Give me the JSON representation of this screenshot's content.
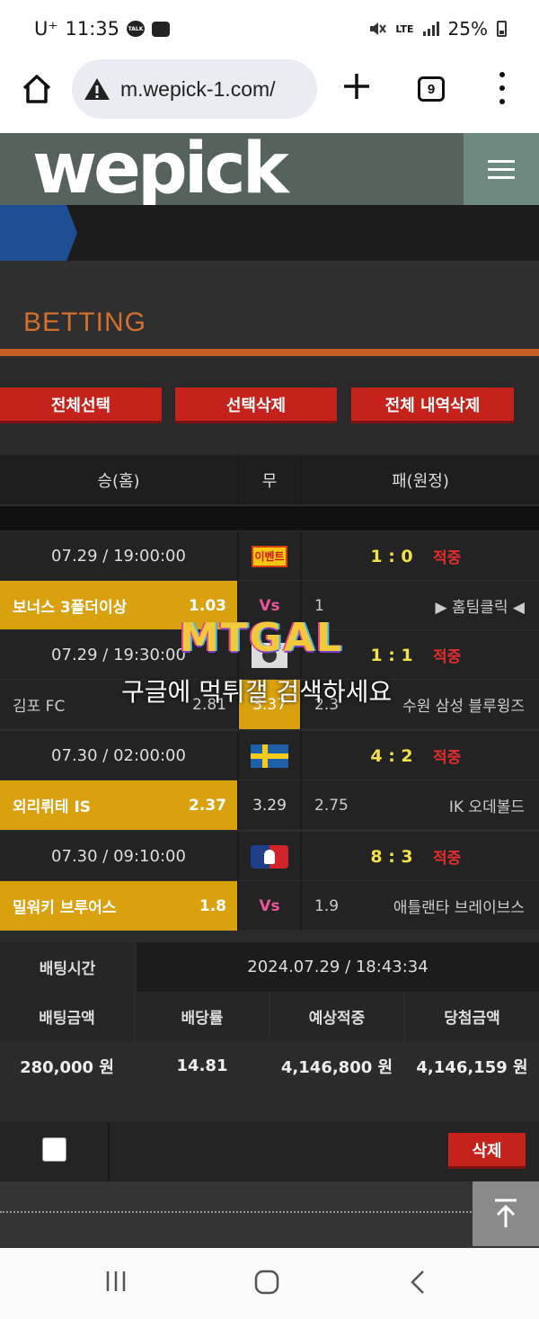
{
  "status_bar": {
    "carrier": "U⁺",
    "time": "11:35",
    "talk_badge": "TALK",
    "network": "LTE",
    "battery": "25%"
  },
  "browser": {
    "url": "m.wepick-1.com/",
    "tab_count": "9"
  },
  "site": {
    "logo": "wepick",
    "section_title": "BETTING"
  },
  "actions": {
    "select_all": "전체선택",
    "delete_selected": "선택삭제",
    "delete_all_history": "전체 내역삭제"
  },
  "table": {
    "headers": {
      "home": "승(홈)",
      "draw": "무",
      "away": "패(원정)"
    },
    "matches": [
      {
        "datetime": "07.29 / 19:00:00",
        "league_badge": "이벤트",
        "score": "1 : 0",
        "result": "적중",
        "home": "보너스 3폴더이상",
        "home_odds": "1.03",
        "draw": "Vs",
        "away_odds": "1",
        "away": "▶ 홈팀클릭 ◀"
      },
      {
        "datetime": "07.29 / 19:30:00",
        "score": "1 : 1",
        "result": "적중",
        "home": "김포 FC",
        "home_odds": "2.81",
        "draw": "3.37",
        "away_odds": "2.3",
        "away": "수원 삼성 블루윙즈"
      },
      {
        "datetime": "07.30 / 02:00:00",
        "score": "4 : 2",
        "result": "적중",
        "home": "외리뤼테 IS",
        "home_odds": "2.37",
        "draw": "3.29",
        "away_odds": "2.75",
        "away": "IK 오데볼드"
      },
      {
        "datetime": "07.30 / 09:10:00",
        "score": "8 : 3",
        "result": "적중",
        "home": "밀워키 브루어스",
        "home_odds": "1.8",
        "draw": "Vs",
        "away_odds": "1.9",
        "away": "애틀랜타 브레이브스"
      }
    ]
  },
  "summary": {
    "bet_time_label": "배팅시간",
    "bet_time_value": "2024.07.29 / 18:43:34",
    "labels": [
      "배팅금액",
      "배당률",
      "예상적중",
      "당첨금액"
    ],
    "values": [
      "280,000 원",
      "14.81",
      "4,146,800 원",
      "4,146,159 원"
    ]
  },
  "controls": {
    "delete": "삭제"
  },
  "watermark": {
    "logo": "MTGAL",
    "text": "구글에 먹튀갤 검색하세요"
  },
  "colors": {
    "accent_orange": "#d3702f",
    "button_red": "#c6221c",
    "selected_gold": "#d9a10e",
    "score_yellow": "#f1e14a",
    "hit_red": "#e32d2d"
  }
}
